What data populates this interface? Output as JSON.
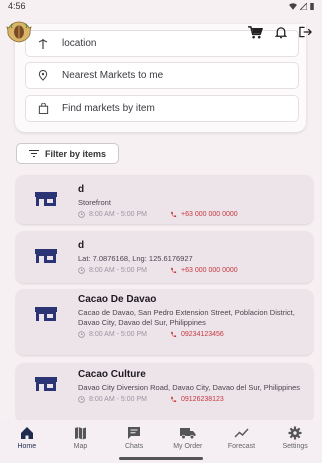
{
  "status_bar": {
    "time": "4:56"
  },
  "colors": {
    "accent": "#2b3576",
    "phone": "#c5383f",
    "background": "#f6f0f3",
    "card": "#ede4ea"
  },
  "options": [
    {
      "label": "location",
      "icon": "location-icon"
    },
    {
      "label": "Nearest Markets to me",
      "icon": "pin-icon"
    },
    {
      "label": "Find markets by item",
      "icon": "bag-icon"
    }
  ],
  "filter": {
    "label": "Filter by items"
  },
  "markets": [
    {
      "name": "d",
      "address": "Storefront",
      "hours": "8:00 AM - 5:00 PM",
      "phone": "+63 000 000 0000"
    },
    {
      "name": "d",
      "address": "Lat: 7.0876168, Lng: 125.6176927",
      "hours": "8:00 AM - 5:00 PM",
      "phone": "+63 000 000 0000"
    },
    {
      "name": "Cacao De Davao",
      "address": "Cacao de Davao, San Pedro Extension Street, Poblacion District, Davao City, Davao del Sur, Philippines",
      "hours": "8:00 AM - 5:00 PM",
      "phone": "09234123456"
    },
    {
      "name": "Cacao Culture",
      "address": "Davao City Diversion Road, Davao City, Davao del Sur, Philippines",
      "hours": "8:00 AM - 5:00 PM",
      "phone": "09126238123"
    }
  ],
  "nav": [
    {
      "label": "Home",
      "icon": "home-icon"
    },
    {
      "label": "Map",
      "icon": "map-icon"
    },
    {
      "label": "Chats",
      "icon": "chat-icon"
    },
    {
      "label": "My Order",
      "icon": "truck-icon"
    },
    {
      "label": "Forecast",
      "icon": "trend-icon"
    },
    {
      "label": "Settings",
      "icon": "gear-icon"
    }
  ]
}
